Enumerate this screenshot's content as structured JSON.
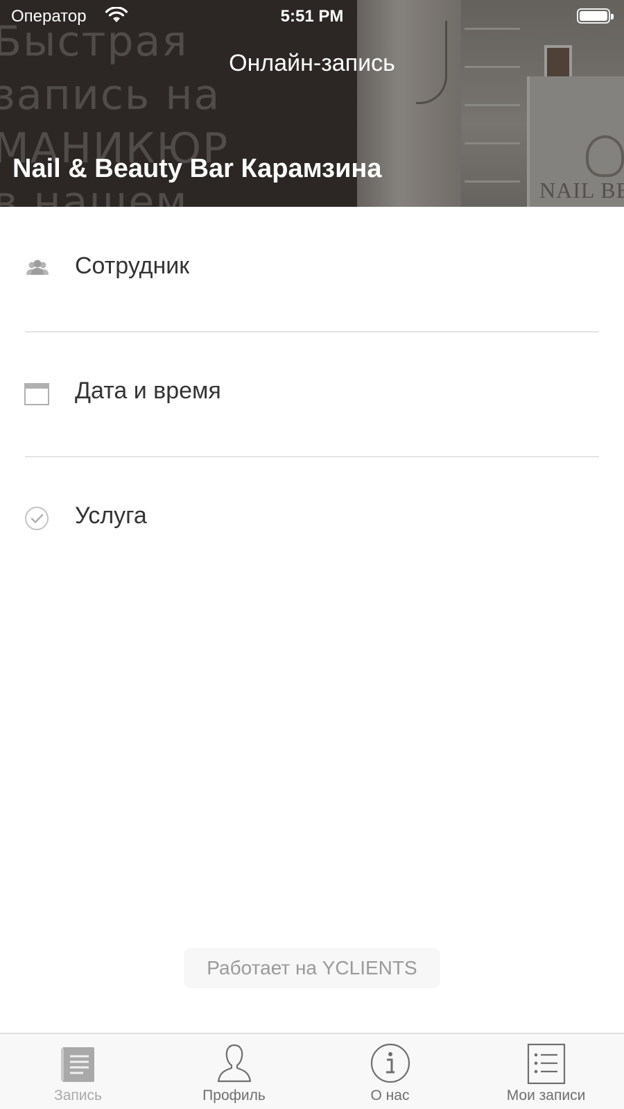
{
  "status_bar": {
    "carrier": "Оператор",
    "time": "5:51 PM",
    "wifi_icon": "wifi-icon",
    "battery_icon": "battery-icon"
  },
  "header": {
    "nav_title": "Онлайн-запись",
    "salon_name": "Nail & Beauty Bar Карамзина",
    "background_promo_text": "Быстрая\nзапись на\nМАНИКЮР\nв нашем",
    "background_logo_text": "NAIL BE"
  },
  "menu": {
    "items": [
      {
        "label": "Сотрудник",
        "icon": "staff-icon"
      },
      {
        "label": "Дата и время",
        "icon": "calendar-icon"
      },
      {
        "label": "Услуга",
        "icon": "checkmark-circle-icon"
      }
    ]
  },
  "powered_by": "Работает на YCLIENTS",
  "tabbar": {
    "tabs": [
      {
        "label": "Запись",
        "icon": "document-icon",
        "active": true
      },
      {
        "label": "Профиль",
        "icon": "profile-icon",
        "active": false
      },
      {
        "label": "О нас",
        "icon": "info-icon",
        "active": false
      },
      {
        "label": "Мои записи",
        "icon": "list-icon",
        "active": false
      }
    ]
  },
  "colors": {
    "header_bg": "#3e3733",
    "text_primary": "#333333",
    "text_secondary": "#9a9a9a",
    "divider": "#e4e4e4",
    "tabbar_bg": "#f8f8f8"
  }
}
